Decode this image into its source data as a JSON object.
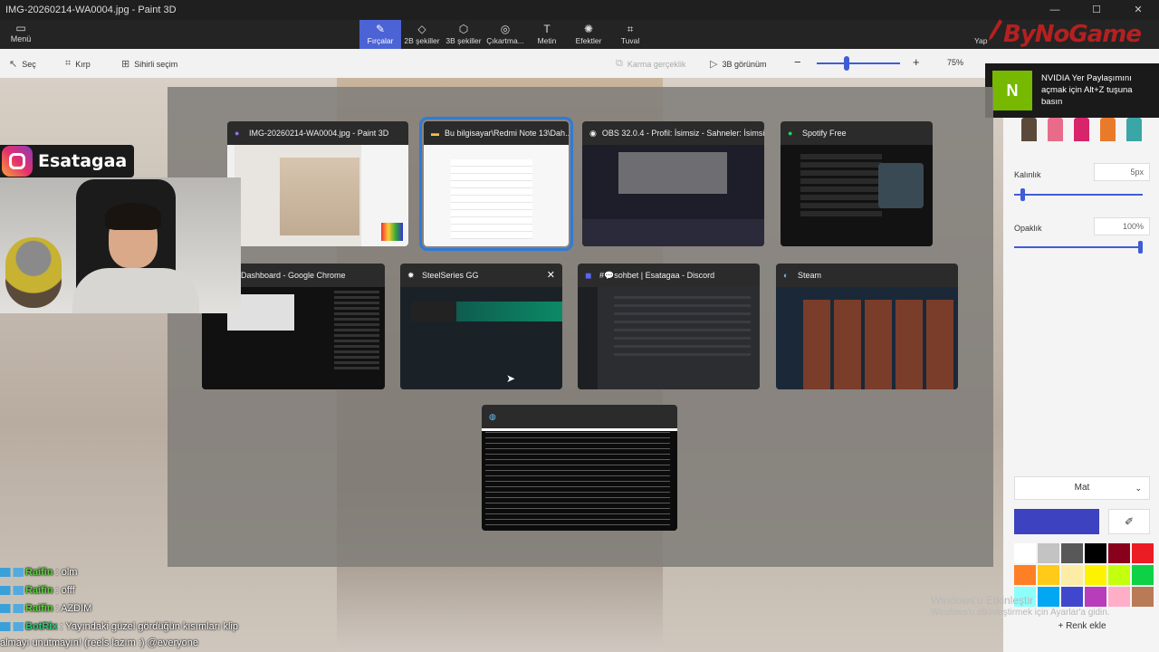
{
  "window": {
    "title": "IMG-20260214-WA0004.jpg - Paint 3D",
    "controls": [
      "—",
      "☐",
      "✕"
    ]
  },
  "ribbon": {
    "menu_label": "Menü",
    "tools": [
      {
        "label": "Fırçalar",
        "icon": "brush-icon",
        "glyph": "✎",
        "active": true
      },
      {
        "label": "2B şekiller",
        "icon": "shapes-2d-icon",
        "glyph": "◇",
        "active": false
      },
      {
        "label": "3B şekiller",
        "icon": "shapes-3d-icon",
        "glyph": "⬡",
        "active": false
      },
      {
        "label": "Çıkartma...",
        "icon": "sticker-icon",
        "glyph": "◎",
        "active": false
      },
      {
        "label": "Metin",
        "icon": "text-icon",
        "glyph": "T",
        "active": false
      },
      {
        "label": "Efektler",
        "icon": "effects-icon",
        "glyph": "✺",
        "active": false
      },
      {
        "label": "Tuval",
        "icon": "canvas-icon",
        "glyph": "⌗",
        "active": false
      }
    ],
    "logo_text": "ByNoGame",
    "partial_label": "Yap"
  },
  "toolbar": {
    "select": "Seç",
    "crop": "Kırp",
    "magic_select": "Sihirli seçim",
    "mixed_reality": "Karma gerçeklik",
    "view_3d": "3B görünüm",
    "zoom_minus": "−",
    "zoom_plus": "+",
    "zoom_level": "75%"
  },
  "nvidia_toast": {
    "logo_text": "N",
    "message": "NVIDIA Yer Paylaşımını açmak için Alt+Z tuşuna basın"
  },
  "right_panel": {
    "thickness_label": "Kalınlık",
    "thickness_value": "5px",
    "thickness_level": 0.05,
    "opacity_label": "Opaklık",
    "opacity_value": "100%",
    "opacity_level": 1.0,
    "finish": "Mat",
    "current_color": "#3c42c0",
    "add_color": "Renk ekle",
    "brush_colors": [
      "#5b4a3a",
      "#e86b8a",
      "#d8246a",
      "#e97a2a",
      "#3aa6a8"
    ],
    "palette": [
      "#ffffff",
      "#c3c3c3",
      "#585858",
      "#000000",
      "#88001b",
      "#ec1c24",
      "#ff7f27",
      "#ffca18",
      "#fdeca6",
      "#fff200",
      "#c4ff0e",
      "#0ed145",
      "#8cfffb",
      "#00a8f3",
      "#3f48cc",
      "#b83dba",
      "#ffaec8",
      "#b97a56"
    ]
  },
  "activation": {
    "title": "Windows'u Etkinleştir",
    "subtitle": "Windows'u etkinleştirmek için Ayarlar'a gidin."
  },
  "task_switcher": {
    "windows": [
      {
        "title": "IMG-20260214-WA0004.jpg - Paint 3D",
        "icon": "paint3d-icon",
        "glyph": "●"
      },
      {
        "title": "Bu bilgisayar\\Redmi Note 13\\Dah...",
        "icon": "folder-icon",
        "glyph": "▬"
      },
      {
        "title": "OBS 32.0.4 - Profil: İsimsiz - Sahneler: İsimsiz",
        "icon": "obs-icon",
        "glyph": "◉"
      },
      {
        "title": "Spotify Free",
        "icon": "spotify-icon",
        "glyph": "●"
      },
      {
        "title": "m - Kick Dashboard - Google Chrome",
        "icon": "chrome-icon",
        "glyph": ""
      },
      {
        "title": "SteelSeries GG",
        "icon": "steelseries-icon",
        "glyph": "✹",
        "close": "✕"
      },
      {
        "title": "#💬sohbet | Esatagaa - Discord",
        "icon": "discord-icon",
        "glyph": "◼"
      },
      {
        "title": "Steam",
        "icon": "steam-icon",
        "glyph": "◐"
      },
      {
        "title": "",
        "icon": "terminal-icon",
        "glyph": "◍"
      }
    ]
  },
  "stream_overlay": {
    "instagram_handle": "Esatagaa",
    "chat": [
      {
        "user": "Raifin",
        "text": ": olm"
      },
      {
        "user": "Raifin",
        "text": ": offf"
      },
      {
        "user": "Raifin",
        "text": ": AZDIM"
      },
      {
        "user": "BotRix",
        "text": ": Yayındaki güzel gördüğün kısımları klip"
      }
    ],
    "chat_continuation": "almayı unutmayın! (reels lazım :) @everyone"
  }
}
